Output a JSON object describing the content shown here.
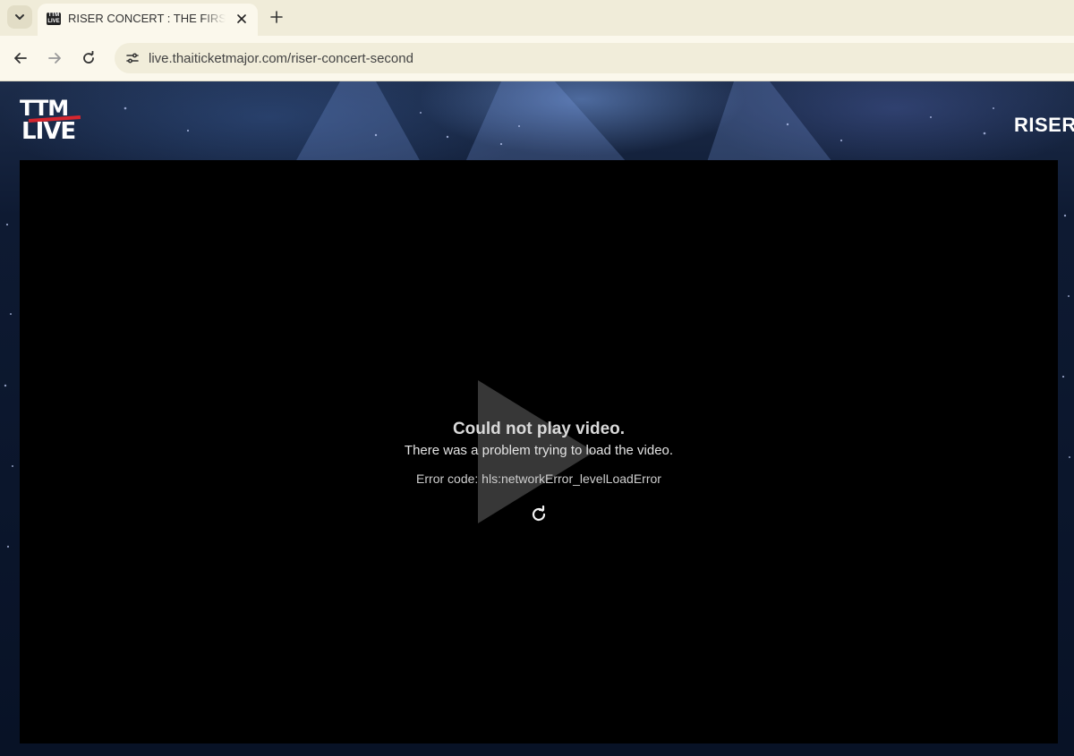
{
  "browser": {
    "tab": {
      "favicon_text": "TTM LIVE",
      "title": "RISER CONCERT : THE FIRST RISE"
    },
    "address_bar": {
      "url": "live.thaiticketmajor.com/riser-concert-second"
    }
  },
  "page": {
    "logo": {
      "line1": "TTM",
      "line2": "LIVE"
    },
    "event_title": "RISER",
    "player": {
      "error_title": "Could not play video.",
      "error_message": "There was a problem trying to load the video.",
      "error_code": "Error code: hls:networkError_levelLoadError"
    }
  },
  "icons": {
    "tab_search": "chevron-down-icon",
    "tab_close": "close-icon",
    "new_tab": "plus-icon",
    "back": "arrow-left-icon",
    "forward": "arrow-right-icon",
    "reload": "reload-icon",
    "site_info": "tune-icon",
    "play": "play-icon",
    "retry": "retry-icon"
  },
  "colors": {
    "chrome_tabbar": "#f0ecd9",
    "chrome_toolbar": "#fbf8ec",
    "player_bg": "#000000",
    "logo_accent": "#d7262e"
  }
}
